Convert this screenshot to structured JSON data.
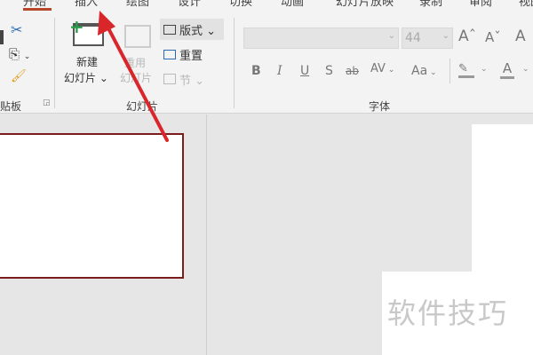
{
  "tabs": [
    "开始",
    "插入",
    "绘图",
    "设计",
    "切换",
    "动画",
    "幻灯片放映",
    "录制",
    "审阅",
    "视图"
  ],
  "clipboard": {
    "label": "贴板"
  },
  "slides_group": {
    "new_slide": [
      "新建",
      "幻灯片"
    ],
    "reuse": [
      "重用",
      "幻灯片"
    ],
    "layout": "版式",
    "reset": "重置",
    "section": "节",
    "label": "幻灯片"
  },
  "font_group": {
    "font_name": "",
    "font_size": "44",
    "bold": "B",
    "italic": "I",
    "underline": "U",
    "shadow": "S",
    "strike": "ab",
    "spacing": "AV",
    "case": "Aa",
    "label": "字体"
  },
  "watermark": "软件技巧",
  "colors": {
    "accent": "#b7472a",
    "arrow": "#d9262b",
    "slide_border": "#7a1c1c"
  }
}
